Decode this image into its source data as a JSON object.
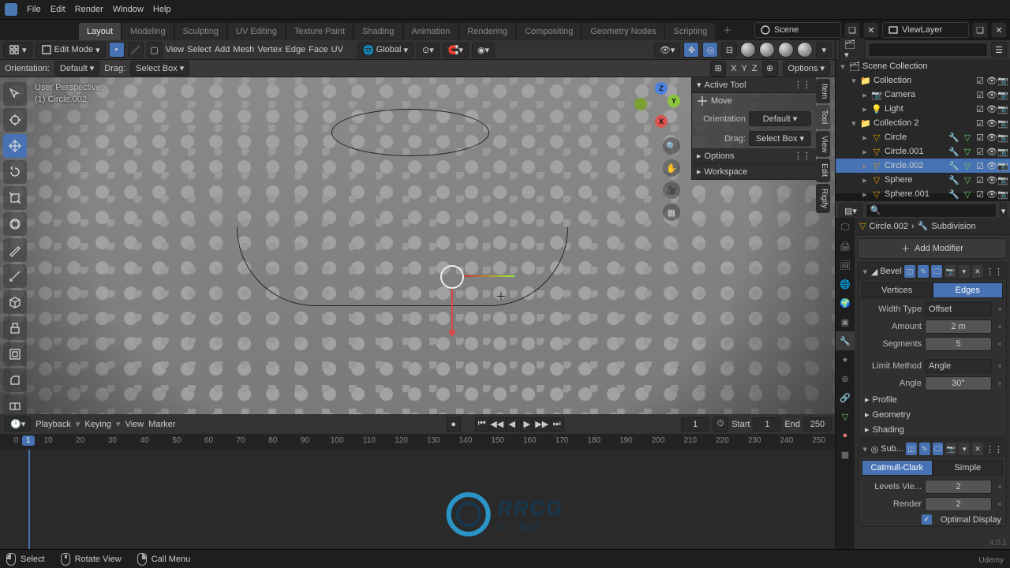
{
  "menu": {
    "items": [
      "File",
      "Edit",
      "Render",
      "Window",
      "Help"
    ]
  },
  "workspaces": {
    "active": "Layout",
    "tabs": [
      "Layout",
      "Modeling",
      "Sculpting",
      "UV Editing",
      "Texture Paint",
      "Shading",
      "Animation",
      "Rendering",
      "Compositing",
      "Geometry Nodes",
      "Scripting"
    ]
  },
  "scene": {
    "label": "Scene",
    "viewlayer": "ViewLayer"
  },
  "header": {
    "mode": "Edit Mode",
    "menus": [
      "View",
      "Select",
      "Add",
      "Mesh",
      "Vertex",
      "Edge",
      "Face",
      "UV"
    ],
    "orientation": "Global"
  },
  "toolsettings": {
    "orientation_label": "Orientation:",
    "orientation_value": "Default",
    "drag_label": "Drag:",
    "drag_value": "Select Box",
    "options_label": "Options"
  },
  "overlay": {
    "line1": "User Perspective",
    "line2": "(1) Circle.002"
  },
  "overlay_axes": {
    "x": "X",
    "y": "Y",
    "z": "Z"
  },
  "n_panel": {
    "active_tool": "Active Tool",
    "tool_name": "Move",
    "orientation_label": "Orientation",
    "orientation_value": "Default",
    "drag_label": "Drag:",
    "drag_value": "Select Box",
    "options": "Options",
    "workspace": "Workspace",
    "tabs": [
      "Item",
      "Tool",
      "View",
      "Edit",
      "Rigify"
    ]
  },
  "timeline": {
    "menus": [
      "Playback",
      "Keying",
      "View",
      "Marker"
    ],
    "current": 1,
    "start_label": "Start",
    "start": 1,
    "end_label": "End",
    "end": 250,
    "ticks": [
      0,
      10,
      20,
      30,
      40,
      50,
      60,
      70,
      80,
      90,
      100,
      110,
      120,
      130,
      140,
      150,
      160,
      170,
      180,
      190,
      200,
      210,
      220,
      230,
      240,
      250
    ]
  },
  "status": {
    "select": "Select",
    "rotate": "Rotate View",
    "menu": "Call Menu"
  },
  "outliner": {
    "root": "Scene Collection",
    "items": [
      {
        "depth": 1,
        "icon": "coll",
        "name": "Collection",
        "tri": "▾"
      },
      {
        "depth": 2,
        "icon": "cam",
        "name": "Camera",
        "tri": "▸"
      },
      {
        "depth": 2,
        "icon": "light",
        "name": "Light",
        "tri": "▸"
      },
      {
        "depth": 1,
        "icon": "coll",
        "name": "Collection 2",
        "tri": "▾"
      },
      {
        "depth": 2,
        "icon": "mesh",
        "name": "Circle",
        "tri": "▸",
        "mods": true
      },
      {
        "depth": 2,
        "icon": "mesh",
        "name": "Circle.001",
        "tri": "▸",
        "mods": true
      },
      {
        "depth": 2,
        "icon": "mesh",
        "name": "Circle.002",
        "tri": "▸",
        "sel": true,
        "mods": true
      },
      {
        "depth": 2,
        "icon": "mesh",
        "name": "Sphere",
        "tri": "▸",
        "mods": true
      },
      {
        "depth": 2,
        "icon": "mesh",
        "name": "Sphere.001",
        "tri": "▸",
        "mods": true
      }
    ]
  },
  "properties": {
    "breadcrumb": {
      "obj": "Circle.002",
      "mod": "Subdivision"
    },
    "add_modifier": "Add Modifier",
    "bevel": {
      "name": "Bevel",
      "mode": {
        "a": "Vertices",
        "b": "Edges"
      },
      "width_type_label": "Width Type",
      "width_type": "Offset",
      "amount_label": "Amount",
      "amount": "2 m",
      "segments_label": "Segments",
      "segments": "5",
      "limit_label": "Limit Method",
      "limit": "Angle",
      "angle_label": "Angle",
      "angle": "30°",
      "panels": [
        "Profile",
        "Geometry",
        "Shading"
      ]
    },
    "subsurf": {
      "name": "Sub...",
      "mode": {
        "a": "Catmull-Clark",
        "b": "Simple"
      },
      "levels_label": "Levels Vie...",
      "levels": "2",
      "render_label": "Render",
      "render": "2",
      "optimal": "Optimal Display"
    }
  },
  "watermark": {
    "big": "RRCG",
    "small": "人人素材"
  },
  "brand": "Udemy",
  "version": "4.0.1"
}
